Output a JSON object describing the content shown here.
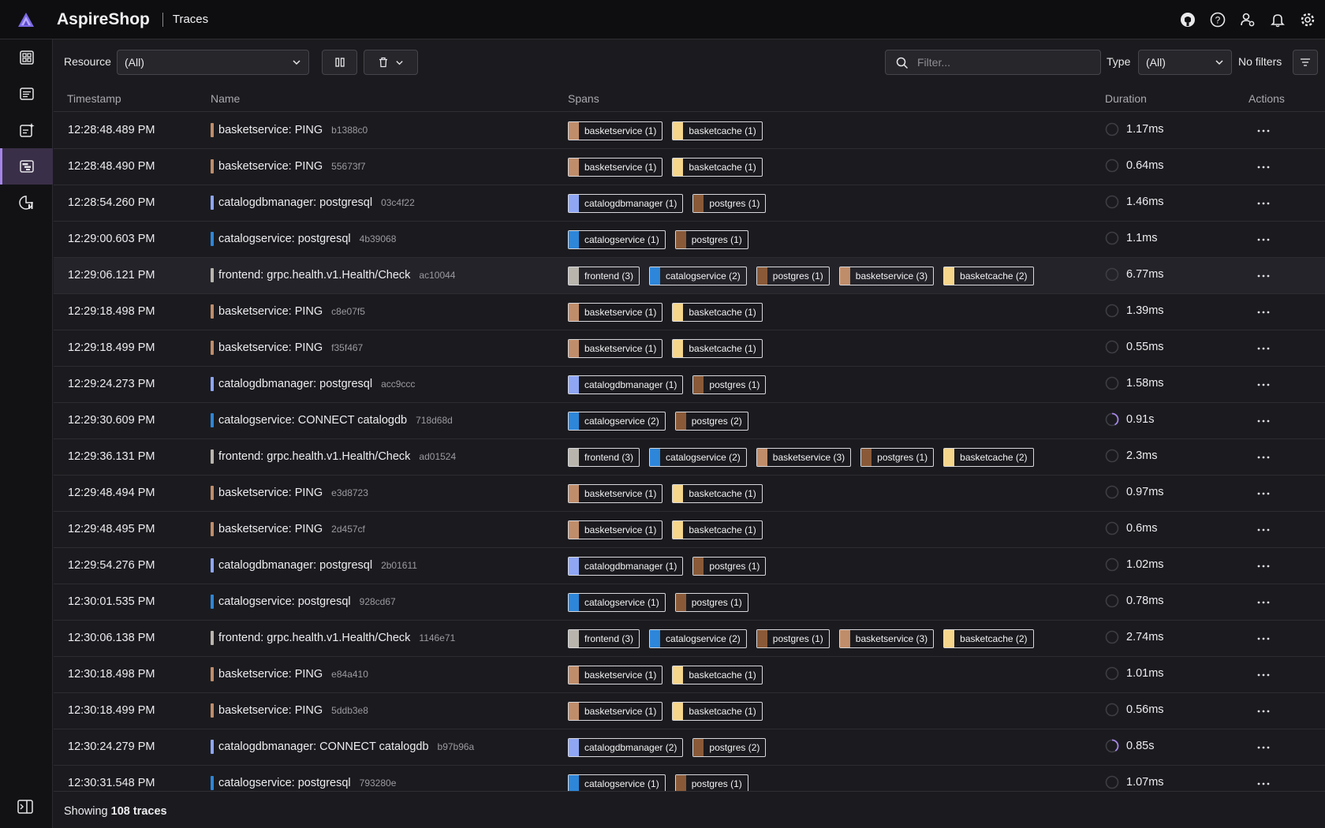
{
  "app": {
    "title": "AspireShop",
    "page": "Traces"
  },
  "colors": {
    "basketservice": "#c08d6a",
    "basketcache": "#f6d68a",
    "catalogdbmanager": "#8ea6f4",
    "catalogservice": "#2d86d9",
    "postgres": "#8a5a38",
    "frontend": "#b9b5ad",
    "accent": "#a585e8"
  },
  "toolbar": {
    "resource_label": "Resource",
    "resource_value": "(All)",
    "filter_placeholder": "Filter...",
    "type_label": "Type",
    "type_value": "(All)",
    "no_filters": "No filters"
  },
  "columns": {
    "timestamp": "Timestamp",
    "name": "Name",
    "spans": "Spans",
    "duration": "Duration",
    "actions": "Actions"
  },
  "rows": [
    {
      "ts": "12:28:48.489 PM",
      "svc": "basketservice",
      "name": "basketservice: PING",
      "id": "b1388c0",
      "spans": [
        [
          "basketservice",
          "basketservice (1)"
        ],
        [
          "basketcache",
          "basketcache (1)"
        ]
      ],
      "dur": "1.17ms",
      "frac": 0
    },
    {
      "ts": "12:28:48.490 PM",
      "svc": "basketservice",
      "name": "basketservice: PING",
      "id": "55673f7",
      "spans": [
        [
          "basketservice",
          "basketservice (1)"
        ],
        [
          "basketcache",
          "basketcache (1)"
        ]
      ],
      "dur": "0.64ms",
      "frac": 0
    },
    {
      "ts": "12:28:54.260 PM",
      "svc": "catalogdbmanager",
      "name": "catalogdbmanager: postgresql",
      "id": "03c4f22",
      "spans": [
        [
          "catalogdbmanager",
          "catalogdbmanager (1)"
        ],
        [
          "postgres",
          "postgres (1)"
        ]
      ],
      "dur": "1.46ms",
      "frac": 0
    },
    {
      "ts": "12:29:00.603 PM",
      "svc": "catalogservice",
      "name": "catalogservice: postgresql",
      "id": "4b39068",
      "spans": [
        [
          "catalogservice",
          "catalogservice (1)"
        ],
        [
          "postgres",
          "postgres (1)"
        ]
      ],
      "dur": "1.1ms",
      "frac": 0
    },
    {
      "ts": "12:29:06.121 PM",
      "svc": "frontend",
      "name": "frontend: grpc.health.v1.Health/Check",
      "id": "ac10044",
      "spans": [
        [
          "frontend",
          "frontend (3)"
        ],
        [
          "catalogservice",
          "catalogservice (2)"
        ],
        [
          "postgres",
          "postgres (1)"
        ],
        [
          "basketservice",
          "basketservice (3)"
        ],
        [
          "basketcache",
          "basketcache (2)"
        ]
      ],
      "dur": "6.77ms",
      "frac": 0,
      "hl": true
    },
    {
      "ts": "12:29:18.498 PM",
      "svc": "basketservice",
      "name": "basketservice: PING",
      "id": "c8e07f5",
      "spans": [
        [
          "basketservice",
          "basketservice (1)"
        ],
        [
          "basketcache",
          "basketcache (1)"
        ]
      ],
      "dur": "1.39ms",
      "frac": 0
    },
    {
      "ts": "12:29:18.499 PM",
      "svc": "basketservice",
      "name": "basketservice: PING",
      "id": "f35f467",
      "spans": [
        [
          "basketservice",
          "basketservice (1)"
        ],
        [
          "basketcache",
          "basketcache (1)"
        ]
      ],
      "dur": "0.55ms",
      "frac": 0
    },
    {
      "ts": "12:29:24.273 PM",
      "svc": "catalogdbmanager",
      "name": "catalogdbmanager: postgresql",
      "id": "acc9ccc",
      "spans": [
        [
          "catalogdbmanager",
          "catalogdbmanager (1)"
        ],
        [
          "postgres",
          "postgres (1)"
        ]
      ],
      "dur": "1.58ms",
      "frac": 0
    },
    {
      "ts": "12:29:30.609 PM",
      "svc": "catalogservice",
      "name": "catalogservice: CONNECT catalogdb",
      "id": "718d68d",
      "spans": [
        [
          "catalogservice",
          "catalogservice (2)"
        ],
        [
          "postgres",
          "postgres (2)"
        ]
      ],
      "dur": "0.91s",
      "frac": 0.42
    },
    {
      "ts": "12:29:36.131 PM",
      "svc": "frontend",
      "name": "frontend: grpc.health.v1.Health/Check",
      "id": "ad01524",
      "spans": [
        [
          "frontend",
          "frontend (3)"
        ],
        [
          "catalogservice",
          "catalogservice (2)"
        ],
        [
          "basketservice",
          "basketservice (3)"
        ],
        [
          "postgres",
          "postgres (1)"
        ],
        [
          "basketcache",
          "basketcache (2)"
        ]
      ],
      "dur": "2.3ms",
      "frac": 0
    },
    {
      "ts": "12:29:48.494 PM",
      "svc": "basketservice",
      "name": "basketservice: PING",
      "id": "e3d8723",
      "spans": [
        [
          "basketservice",
          "basketservice (1)"
        ],
        [
          "basketcache",
          "basketcache (1)"
        ]
      ],
      "dur": "0.97ms",
      "frac": 0
    },
    {
      "ts": "12:29:48.495 PM",
      "svc": "basketservice",
      "name": "basketservice: PING",
      "id": "2d457cf",
      "spans": [
        [
          "basketservice",
          "basketservice (1)"
        ],
        [
          "basketcache",
          "basketcache (1)"
        ]
      ],
      "dur": "0.6ms",
      "frac": 0
    },
    {
      "ts": "12:29:54.276 PM",
      "svc": "catalogdbmanager",
      "name": "catalogdbmanager: postgresql",
      "id": "2b01611",
      "spans": [
        [
          "catalogdbmanager",
          "catalogdbmanager (1)"
        ],
        [
          "postgres",
          "postgres (1)"
        ]
      ],
      "dur": "1.02ms",
      "frac": 0
    },
    {
      "ts": "12:30:01.535 PM",
      "svc": "catalogservice",
      "name": "catalogservice: postgresql",
      "id": "928cd67",
      "spans": [
        [
          "catalogservice",
          "catalogservice (1)"
        ],
        [
          "postgres",
          "postgres (1)"
        ]
      ],
      "dur": "0.78ms",
      "frac": 0
    },
    {
      "ts": "12:30:06.138 PM",
      "svc": "frontend",
      "name": "frontend: grpc.health.v1.Health/Check",
      "id": "1146e71",
      "spans": [
        [
          "frontend",
          "frontend (3)"
        ],
        [
          "catalogservice",
          "catalogservice (2)"
        ],
        [
          "postgres",
          "postgres (1)"
        ],
        [
          "basketservice",
          "basketservice (3)"
        ],
        [
          "basketcache",
          "basketcache (2)"
        ]
      ],
      "dur": "2.74ms",
      "frac": 0
    },
    {
      "ts": "12:30:18.498 PM",
      "svc": "basketservice",
      "name": "basketservice: PING",
      "id": "e84a410",
      "spans": [
        [
          "basketservice",
          "basketservice (1)"
        ],
        [
          "basketcache",
          "basketcache (1)"
        ]
      ],
      "dur": "1.01ms",
      "frac": 0
    },
    {
      "ts": "12:30:18.499 PM",
      "svc": "basketservice",
      "name": "basketservice: PING",
      "id": "5ddb3e8",
      "spans": [
        [
          "basketservice",
          "basketservice (1)"
        ],
        [
          "basketcache",
          "basketcache (1)"
        ]
      ],
      "dur": "0.56ms",
      "frac": 0
    },
    {
      "ts": "12:30:24.279 PM",
      "svc": "catalogdbmanager",
      "name": "catalogdbmanager: CONNECT catalogdb",
      "id": "b97b96a",
      "spans": [
        [
          "catalogdbmanager",
          "catalogdbmanager (2)"
        ],
        [
          "postgres",
          "postgres (2)"
        ]
      ],
      "dur": "0.85s",
      "frac": 0.4
    },
    {
      "ts": "12:30:31.548 PM",
      "svc": "catalogservice",
      "name": "catalogservice: postgresql",
      "id": "793280e",
      "spans": [
        [
          "catalogservice",
          "catalogservice (1)"
        ],
        [
          "postgres",
          "postgres (1)"
        ]
      ],
      "dur": "1.07ms",
      "frac": 0
    }
  ],
  "footer": {
    "prefix": "Showing",
    "count": "108 traces"
  }
}
